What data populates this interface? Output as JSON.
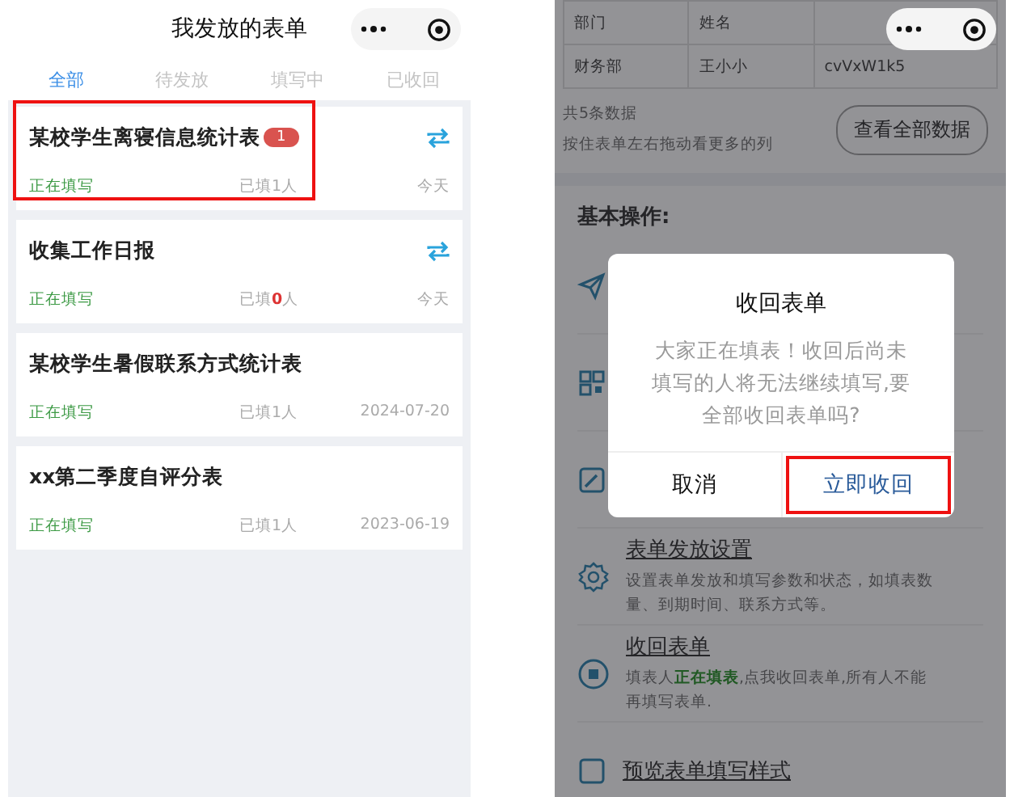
{
  "left": {
    "title": "我发放的表单",
    "tabs": [
      {
        "label": "全部",
        "selected": true
      },
      {
        "label": "待发放",
        "selected": false
      },
      {
        "label": "填写中",
        "selected": false
      },
      {
        "label": "已收回",
        "selected": false
      }
    ],
    "forms": [
      {
        "title": "某校学生离寝信息统计表",
        "badge": "1",
        "sync": true,
        "status": "正在填写",
        "filled": [
          "已填",
          "1",
          "人"
        ],
        "count_alert": false,
        "date": "今天",
        "highlighted": true
      },
      {
        "title": "收集工作日报",
        "sync": true,
        "status": "正在填写",
        "filled": [
          "已填",
          "0",
          "人"
        ],
        "count_alert": true,
        "date": "今天",
        "highlighted": false
      },
      {
        "title": "某校学生暑假联系方式统计表",
        "sync": false,
        "status": "正在填写",
        "filled": [
          "已填",
          "1",
          "人"
        ],
        "count_alert": false,
        "date": "2024-07-20",
        "highlighted": false
      },
      {
        "title": "xx第二季度自评分表",
        "sync": false,
        "status": "正在填写",
        "filled": [
          "已填",
          "1",
          "人"
        ],
        "count_alert": false,
        "date": "2023-06-19",
        "highlighted": false
      }
    ]
  },
  "right": {
    "table": {
      "columns": [
        "部门",
        "姓名"
      ],
      "rows": [
        [
          "财务部",
          "王小小",
          "cvVxW1k5"
        ]
      ]
    },
    "total": "共5条数据",
    "hint": "按住表单左右拖动看更多的列",
    "view_all_button": "查看全部数据",
    "section_title": "基本操作:",
    "actions": [
      {
        "kind": "send"
      },
      {
        "kind": "qr"
      },
      {
        "kind": "edit"
      },
      {
        "kind": "gear",
        "title": "表单发放设置",
        "desc": [
          {
            "text": "设置表单发放和填写参数和状态，如填表数量、到期时间、联系方式等。",
            "highlight": false
          }
        ]
      },
      {
        "kind": "stop",
        "title": "收回表单",
        "desc": [
          {
            "text": "填表人",
            "highlight": false
          },
          {
            "text": "正在填表",
            "highlight": true
          },
          {
            "text": ",点我收回表单,所有人不能再填写表单.",
            "highlight": false
          }
        ]
      },
      {
        "kind": "preview",
        "title": "预览表单填写样式"
      }
    ],
    "dialog": {
      "title": "收回表单",
      "message": "大家正在填表！收回后尚未填写的人将无法继续填写,要全部收回表单吗?",
      "buttons": [
        {
          "label": "取消",
          "kind": "cancel",
          "highlighted": false
        },
        {
          "label": "立即收回",
          "kind": "confirm",
          "highlighted": true
        }
      ]
    }
  }
}
